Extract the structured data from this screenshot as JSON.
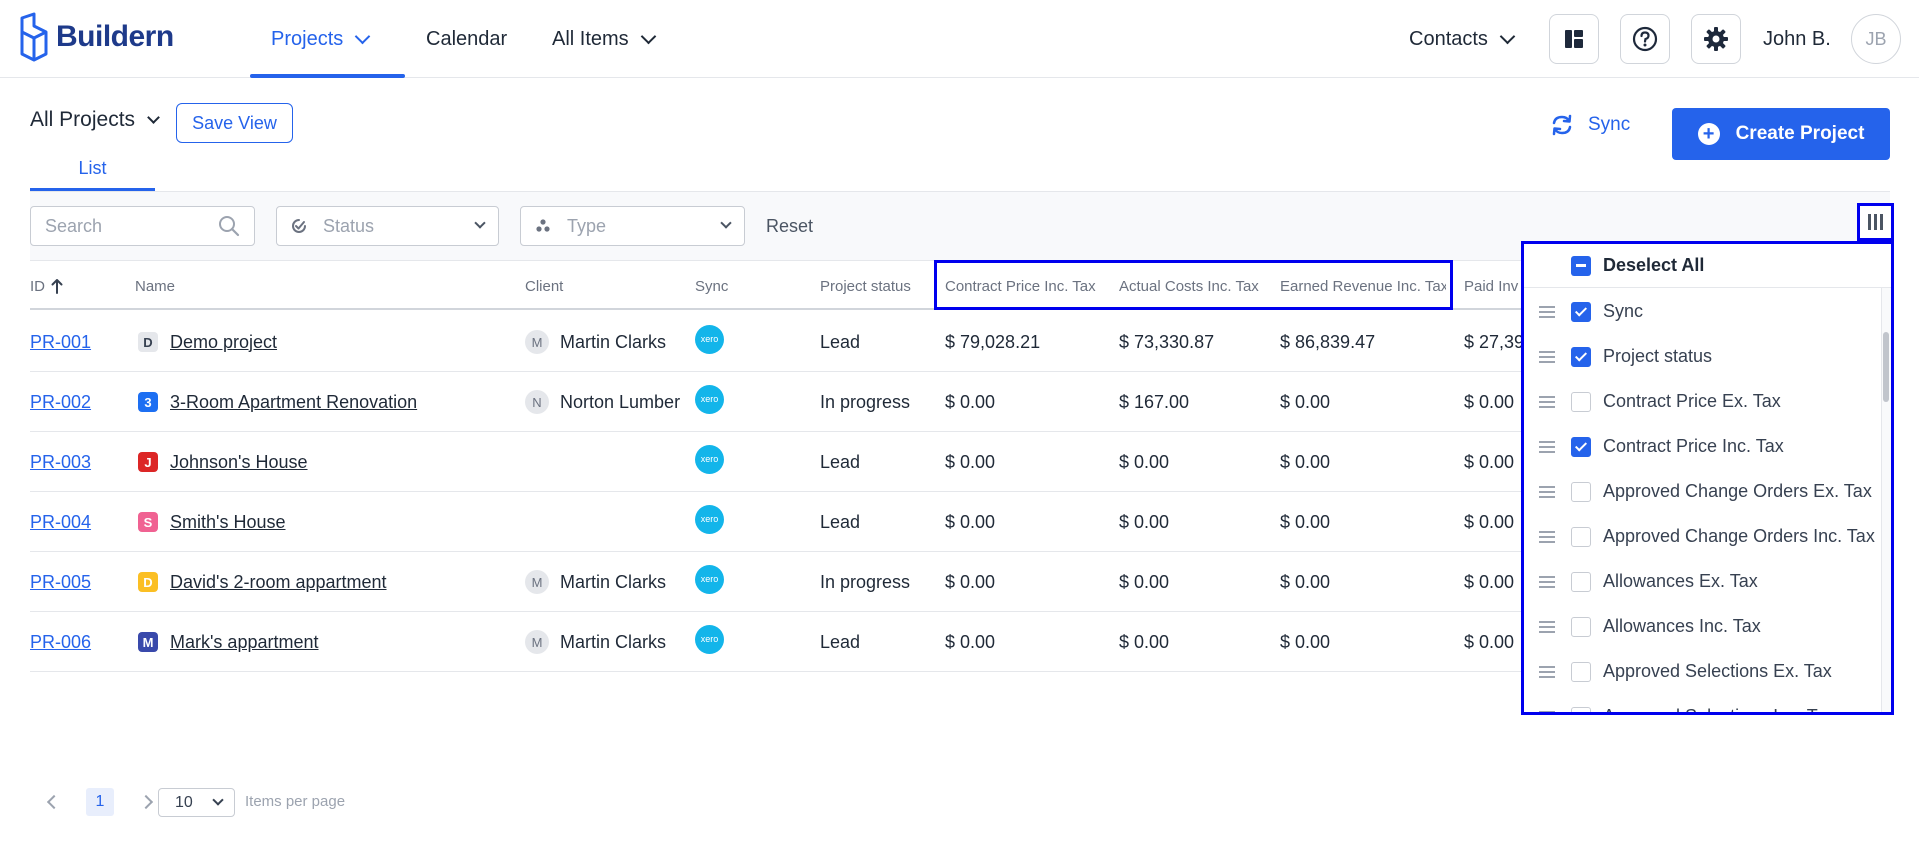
{
  "brand": {
    "name": "Buildern"
  },
  "nav": {
    "projects": "Projects",
    "calendar": "Calendar",
    "all_items": "All Items",
    "contacts": "Contacts"
  },
  "user": {
    "name": "John B.",
    "initials": "JB"
  },
  "header": {
    "view_label": "All Projects",
    "save_view": "Save View",
    "sync": "Sync",
    "create_project": "Create Project",
    "tab_list": "List"
  },
  "filters": {
    "search_placeholder": "Search",
    "status_placeholder": "Status",
    "type_placeholder": "Type",
    "reset": "Reset"
  },
  "table": {
    "columns": [
      "ID",
      "Name",
      "Client",
      "Sync",
      "Project status",
      "Contract Price Inc. Tax",
      "Actual Costs Inc. Tax",
      "Earned Revenue Inc. Tax",
      "Paid Inv"
    ],
    "sync_logo": "xero",
    "rows": [
      {
        "id": "PR-001",
        "badge": "D",
        "badge_color": "#e5e7eb",
        "badge_text_color": "#374151",
        "name": "Demo project",
        "client_initial": "M",
        "client": "Martin Clarks",
        "status": "Lead",
        "contract": "$ 79,028.21",
        "actual": "$ 73,330.87",
        "earned": "$ 86,839.47",
        "paid": "$ 27,39"
      },
      {
        "id": "PR-002",
        "badge": "3",
        "badge_color": "#1d6ff2",
        "badge_text_color": "#ffffff",
        "name": "3-Room Apartment Renovation",
        "client_initial": "N",
        "client": "Norton Lumber",
        "status": "In progress",
        "contract": "$ 0.00",
        "actual": "$ 167.00",
        "earned": "$ 0.00",
        "paid": "$ 0.00"
      },
      {
        "id": "PR-003",
        "badge": "J",
        "badge_color": "#dc2626",
        "badge_text_color": "#ffffff",
        "name": "Johnson's House",
        "client_initial": "",
        "client": "",
        "status": "Lead",
        "contract": "$ 0.00",
        "actual": "$ 0.00",
        "earned": "$ 0.00",
        "paid": "$ 0.00"
      },
      {
        "id": "PR-004",
        "badge": "S",
        "badge_color": "#f06292",
        "badge_text_color": "#ffffff",
        "name": "Smith's House",
        "client_initial": "",
        "client": "",
        "status": "Lead",
        "contract": "$ 0.00",
        "actual": "$ 0.00",
        "earned": "$ 0.00",
        "paid": "$ 0.00"
      },
      {
        "id": "PR-005",
        "badge": "D",
        "badge_color": "#fbbf24",
        "badge_text_color": "#ffffff",
        "name": "David's 2-room appartment",
        "client_initial": "M",
        "client": "Martin Clarks",
        "status": "In progress",
        "contract": "$ 0.00",
        "actual": "$ 0.00",
        "earned": "$ 0.00",
        "paid": "$ 0.00"
      },
      {
        "id": "PR-006",
        "badge": "M",
        "badge_color": "#3949ab",
        "badge_text_color": "#ffffff",
        "name": "Mark's appartment",
        "client_initial": "M",
        "client": "Martin Clarks",
        "status": "Lead",
        "contract": "$ 0.00",
        "actual": "$ 0.00",
        "earned": "$ 0.00",
        "paid": "$ 0.00"
      }
    ]
  },
  "pagination": {
    "current_page": "1",
    "per_page": "10",
    "per_page_label": "Items per page"
  },
  "column_panel": {
    "deselect_all": "Deselect All",
    "items": [
      {
        "label": "Sync",
        "checked": true
      },
      {
        "label": "Project status",
        "checked": true
      },
      {
        "label": "Contract Price Ex. Tax",
        "checked": false
      },
      {
        "label": "Contract Price Inc. Tax",
        "checked": true
      },
      {
        "label": "Approved Change Orders Ex. Tax",
        "checked": false
      },
      {
        "label": "Approved Change Orders Inc. Tax",
        "checked": false
      },
      {
        "label": "Allowances Ex. Tax",
        "checked": false
      },
      {
        "label": "Allowances Inc. Tax",
        "checked": false
      },
      {
        "label": "Approved Selections Ex. Tax",
        "checked": false
      },
      {
        "label": "Approved Selections Inc. Tax",
        "checked": false
      }
    ]
  },
  "colors": {
    "accent": "#2563eb",
    "highlight": "#0000ee",
    "xero": "#13b5ea"
  }
}
